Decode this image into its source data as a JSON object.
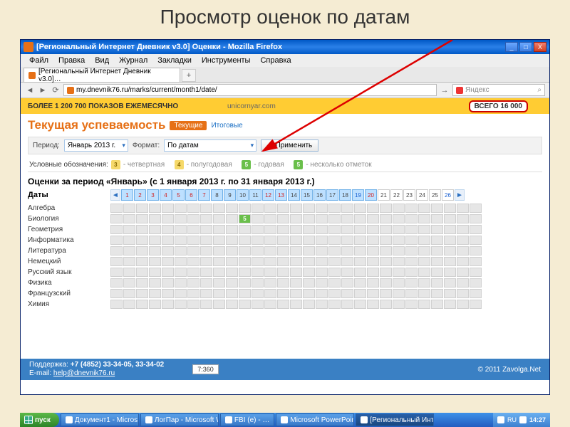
{
  "slide_title": "Просмотр оценок по датам",
  "window": {
    "title": "[Региональный Интернет Дневник v3.0] Оценки - Mozilla Firefox",
    "winctl": {
      "min": "_",
      "max": "□",
      "close": "X"
    }
  },
  "menu": {
    "file": "Файл",
    "edit": "Правка",
    "view": "Вид",
    "history": "Журнал",
    "bookmarks": "Закладки",
    "tools": "Инструменты",
    "help": "Справка"
  },
  "tab": {
    "label": "[Региональный Интернет Дневник v3.0]…",
    "add": "+"
  },
  "urlbar": {
    "back": "◄",
    "fwd": "►",
    "reload": "⟳",
    "goto": "→",
    "url": "my.dnevnik76.ru/marks/current/month1/date/",
    "search_placeholder": "Яндекс",
    "search_icon": "⌕"
  },
  "banner": {
    "main": "БОЛЕЕ 1 200 700 ПОКАЗОВ ЕЖЕМЕСЯЧНО",
    "uni": "unicornyar.com",
    "bsego": "ВСЕГО 16 000"
  },
  "page": {
    "heading": "Текущая успеваемость",
    "pill_current": "Текущие",
    "link_final": "Итоговые",
    "filter": {
      "period_label": "Период:",
      "period_value": "Январь 2013 г.",
      "format_label": "Формат:",
      "format_value": "По датам",
      "apply": "Применить",
      "apply_check": "✓"
    },
    "legend": {
      "intro": "Условные обозначения:",
      "b3": "3",
      "b3_t": "- четвертная",
      "b4": "4",
      "b4_t": "- полугодовая",
      "b5a": "5",
      "b5a_t": "- годовая",
      "b5b": "5",
      "b5b_t": "- несколько отметок"
    },
    "period_title": "Оценки за период «Январь» (с 1 января 2013 г. по 31 января 2013 г.)",
    "dates_label": "Даты",
    "prev": "◄",
    "next": "►",
    "days": [
      {
        "n": "1",
        "c": "red"
      },
      {
        "n": "2",
        "c": "red"
      },
      {
        "n": "3",
        "c": "red"
      },
      {
        "n": "4",
        "c": "red"
      },
      {
        "n": "5",
        "c": "red"
      },
      {
        "n": "6",
        "c": "red"
      },
      {
        "n": "7",
        "c": "red"
      },
      {
        "n": "8",
        "c": ""
      },
      {
        "n": "9",
        "c": ""
      },
      {
        "n": "10",
        "c": ""
      },
      {
        "n": "11",
        "c": ""
      },
      {
        "n": "12",
        "c": "red"
      },
      {
        "n": "13",
        "c": "red"
      },
      {
        "n": "14",
        "c": ""
      },
      {
        "n": "15",
        "c": ""
      },
      {
        "n": "16",
        "c": ""
      },
      {
        "n": "17",
        "c": ""
      },
      {
        "n": "18",
        "c": ""
      },
      {
        "n": "19",
        "c": "blue"
      },
      {
        "n": "20",
        "c": "red"
      },
      {
        "n": "21",
        "c": ""
      },
      {
        "n": "22",
        "c": ""
      },
      {
        "n": "23",
        "c": ""
      },
      {
        "n": "24",
        "c": ""
      },
      {
        "n": "25",
        "c": ""
      },
      {
        "n": "26",
        "c": "blue"
      }
    ],
    "selected_days": [
      "1",
      "2",
      "3",
      "4",
      "5",
      "6",
      "7",
      "8",
      "9",
      "10",
      "11",
      "12",
      "13",
      "14",
      "15",
      "16",
      "17",
      "18",
      "19",
      "20"
    ],
    "subjects": [
      "Алгебра",
      "Биология",
      "Геометрия",
      "Информатика",
      "Литература",
      "Немецкий",
      "Русский язык",
      "Физика",
      "Французский",
      "Химия"
    ],
    "marks": [
      {
        "subject": "Биология",
        "day": "11",
        "value": "5"
      }
    ]
  },
  "footer": {
    "support_label": "Поддержка:",
    "phones": "+7 (4852) 33-34-05, 33-34-02",
    "email_label": "E-mail:",
    "email": "help@dnevnik76.ru",
    "clock": "7:360",
    "copyright": "© 2011 Zavolga.Net"
  },
  "taskbar": {
    "start": "пуск",
    "items": [
      "Документ1 - Micros…",
      "ЛогПар - Microsoft W…",
      "FBI (e) - …",
      "Microsoft PowerPoint …",
      "[Региональный Инт…"
    ],
    "active_index": 4,
    "lang": "RU",
    "time": "14:27"
  }
}
